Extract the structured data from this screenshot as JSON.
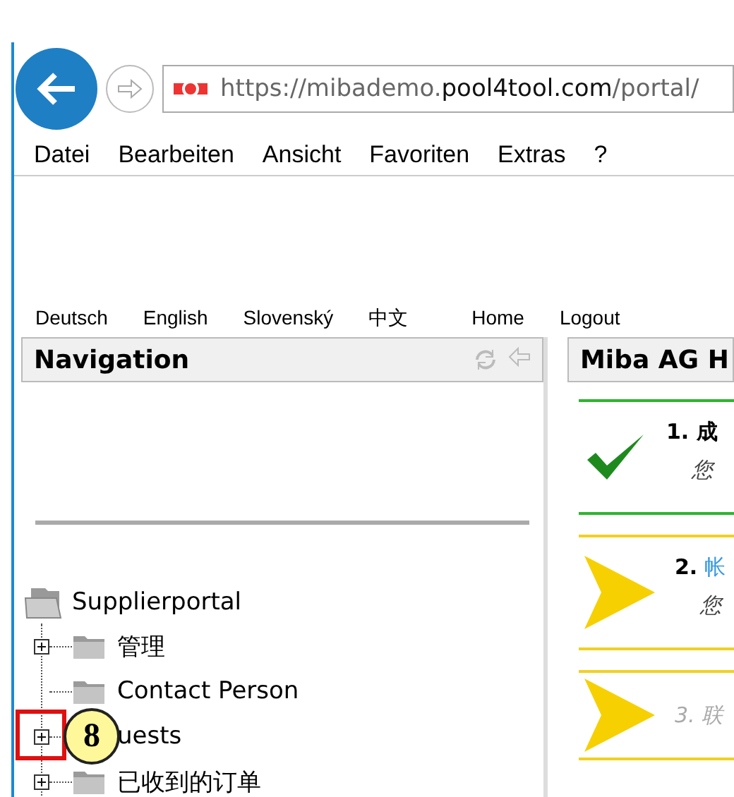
{
  "browser": {
    "url": "https://mibademo.**pool4tool.com**/portal/",
    "menu": [
      "Datei",
      "Bearbeiten",
      "Ansicht",
      "Favoriten",
      "Extras",
      "?"
    ]
  },
  "top_links": [
    "Deutsch",
    "English",
    "Slovenský",
    "中文",
    "Home",
    "Logout"
  ],
  "navigation": {
    "title": "Navigation",
    "tree": {
      "label": "Supplierportal",
      "children": [
        {
          "label": "管理",
          "expandable": true,
          "highlighted": false
        },
        {
          "label": "Contact Person",
          "expandable": false,
          "highlighted": false
        },
        {
          "label": "uests",
          "expandable": true,
          "highlighted": true
        },
        {
          "label": "已收到的订单",
          "expandable": true,
          "highlighted": false
        }
      ]
    }
  },
  "callout": {
    "label": "8"
  },
  "main": {
    "title": "Miba AG H",
    "steps": [
      {
        "kind": "done",
        "title": "1. 成",
        "subtitle": "您"
      },
      {
        "kind": "current",
        "number": "2.",
        "link": "帐",
        "subtitle": "您"
      },
      {
        "kind": "pending",
        "title": "3. 联"
      }
    ]
  }
}
